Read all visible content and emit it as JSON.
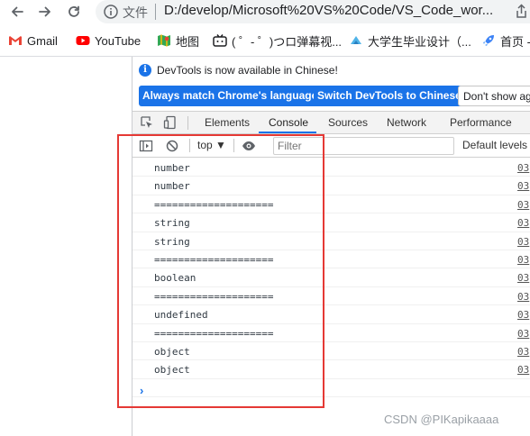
{
  "browser": {
    "omnibox": {
      "scheme_label": "文件",
      "url": "D:/develop/Microsoft%20VS%20Code/VS_Code_wor..."
    },
    "bookmarks": [
      {
        "label": "Gmail",
        "icon": "gmail-icon"
      },
      {
        "label": "YouTube",
        "icon": "youtube-icon"
      },
      {
        "label": "地图",
        "icon": "maps-icon"
      },
      {
        "label": "( ゜- ゜)つロ弹幕视...",
        "icon": "bilibili-icon"
      },
      {
        "label": "大学生毕业设计（...",
        "icon": "bookmark-site-icon"
      },
      {
        "label": "首页 -",
        "icon": "rocket-icon"
      }
    ]
  },
  "devtools": {
    "infobar": {
      "message": "DevTools is now available in Chinese!",
      "btn_match": "Always match Chrome's language",
      "btn_switch": "Switch DevTools to Chinese",
      "btn_dont": "Don't show ag"
    },
    "tabs": [
      {
        "label": "Elements"
      },
      {
        "label": "Console"
      },
      {
        "label": "Sources"
      },
      {
        "label": "Network"
      },
      {
        "label": "Performance"
      }
    ],
    "active_tab": "Console",
    "console": {
      "context": "top ▼",
      "filter_placeholder": "Filter",
      "levels": "Default levels",
      "lines": [
        {
          "text": "number",
          "src": "03"
        },
        {
          "text": "number",
          "src": "03"
        },
        {
          "text": "====================",
          "src": "03"
        },
        {
          "text": "string",
          "src": "03"
        },
        {
          "text": "string",
          "src": "03"
        },
        {
          "text": "====================",
          "src": "03"
        },
        {
          "text": "boolean",
          "src": "03"
        },
        {
          "text": "====================",
          "src": "03"
        },
        {
          "text": "undefined",
          "src": "03"
        },
        {
          "text": "====================",
          "src": "03"
        },
        {
          "text": "object",
          "src": "03"
        },
        {
          "text": "object",
          "src": "03"
        }
      ],
      "prompt": "›"
    }
  },
  "colors": {
    "accent": "#1a73e8",
    "highlight": "#e53935"
  },
  "watermark": "CSDN @PIKapikaaaa"
}
